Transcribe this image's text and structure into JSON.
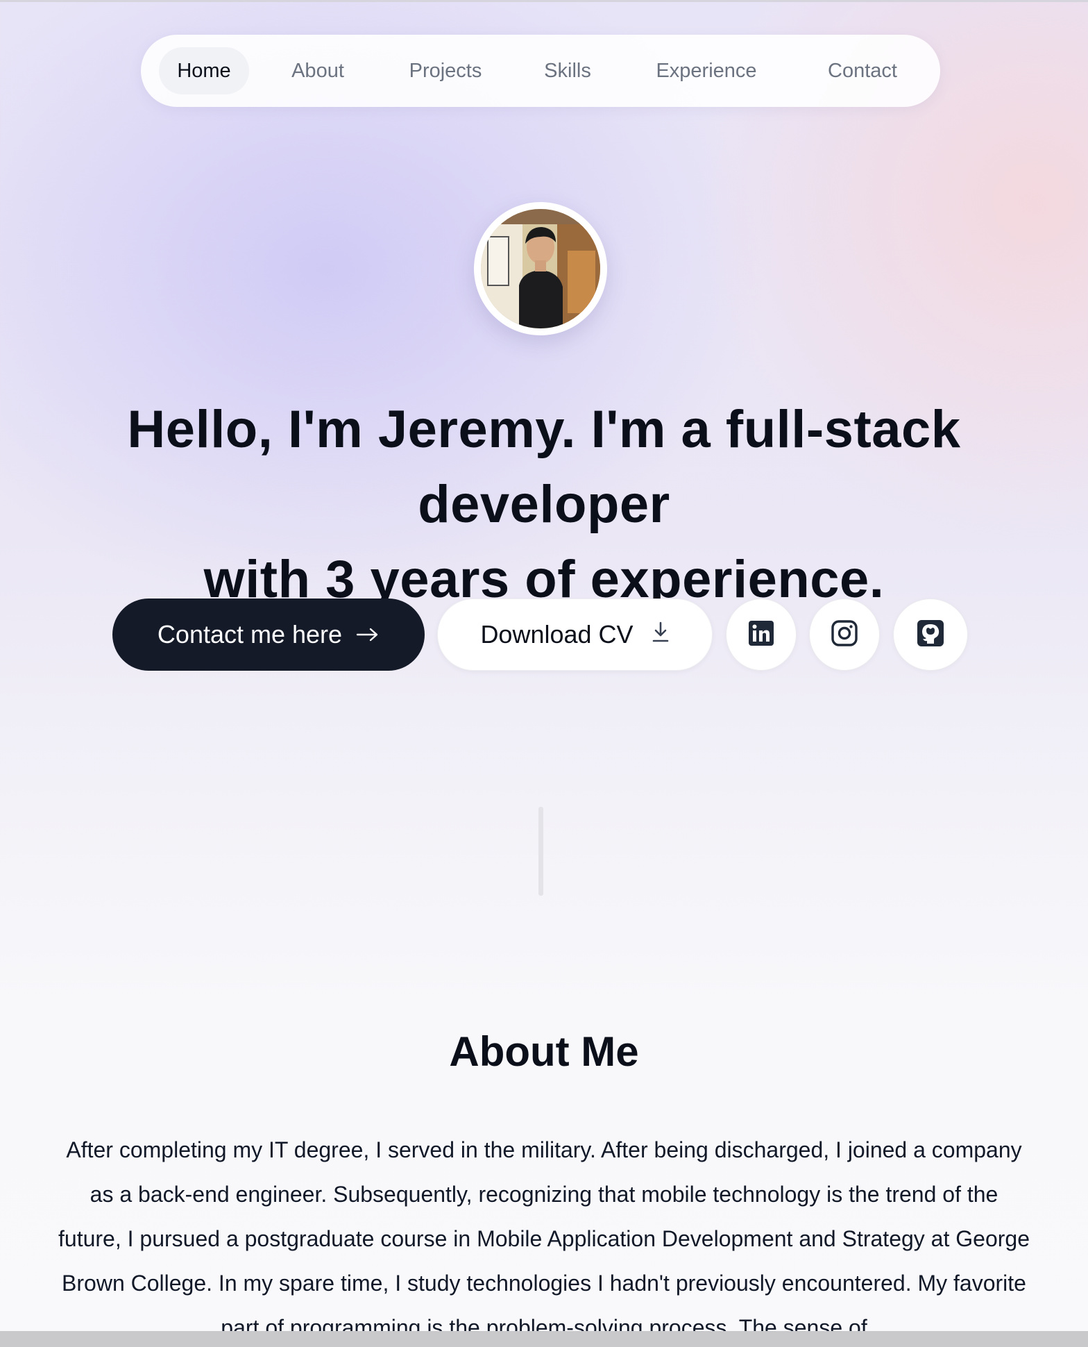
{
  "nav": {
    "items": [
      {
        "label": "Home",
        "active": true
      },
      {
        "label": "About",
        "active": false
      },
      {
        "label": "Projects",
        "active": false
      },
      {
        "label": "Skills",
        "active": false
      },
      {
        "label": "Experience",
        "active": false
      },
      {
        "label": "Contact",
        "active": false
      }
    ]
  },
  "hero": {
    "headline_line1": "Hello, I'm Jeremy. I'm a full-stack developer",
    "headline_line2": "with 3 years of experience.",
    "contact_button": "Contact me here",
    "cv_button": "Download CV",
    "social_icons": [
      "linkedin-icon",
      "instagram-icon",
      "github-icon"
    ]
  },
  "about": {
    "title": "About Me",
    "text": "After completing my IT degree, I served in the military. After being discharged, I joined a company as a back-end engineer. Subsequently, recognizing that mobile technology is the trend of the future, I pursued a postgraduate course in Mobile Application Development and Strategy at George Brown College. In my spare time, I study technologies I hadn't previously encountered. My favorite part of programming is the problem-solving process. The sense of"
  },
  "colors": {
    "primary_button": "#141a28",
    "text": "#0b0f1a",
    "muted_nav": "#6b7280"
  }
}
